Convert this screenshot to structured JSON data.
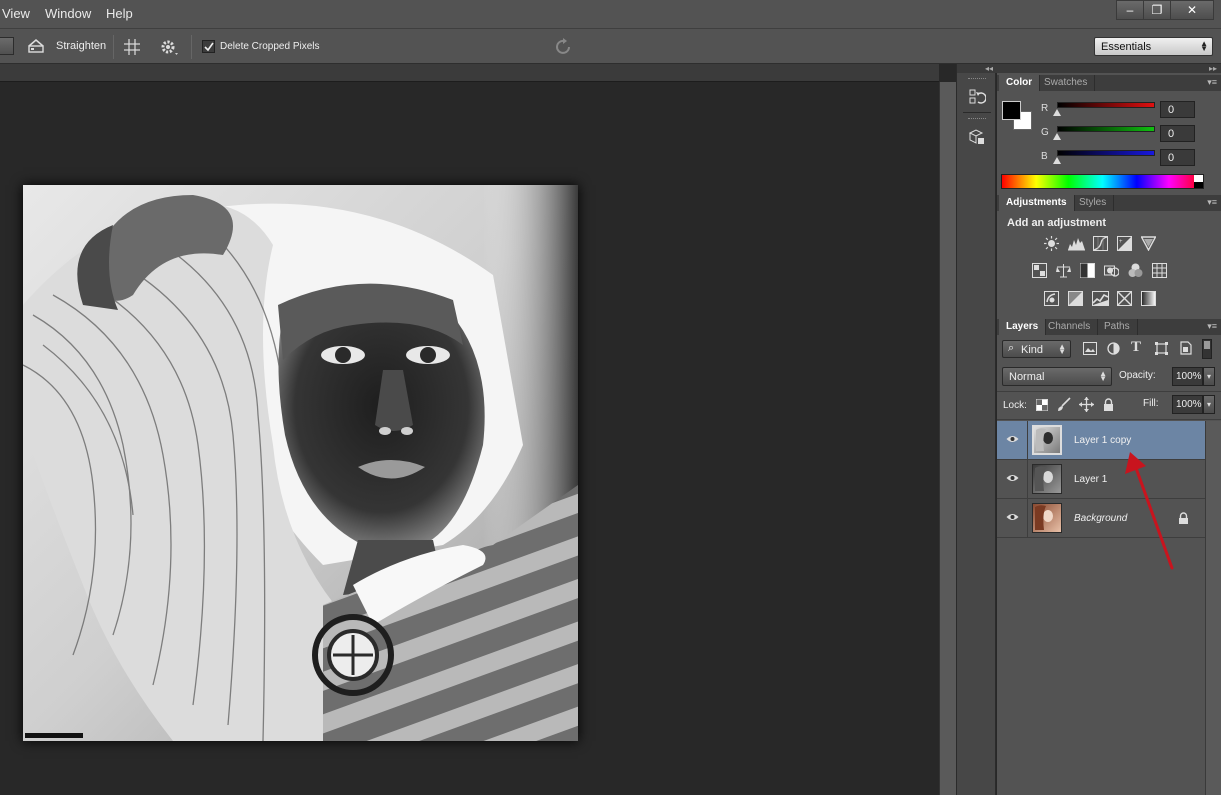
{
  "menu": {
    "items": [
      "View",
      "Window",
      "Help"
    ]
  },
  "window_controls": {
    "minimize": "–",
    "restore": "❐",
    "close": "✕"
  },
  "options_bar": {
    "straighten_label": "Straighten",
    "delete_cropped_label": "Delete Cropped Pixels",
    "delete_cropped_checked": true,
    "workspace_value": "Essentials"
  },
  "color_panel": {
    "tabs": [
      "Color",
      "Swatches"
    ],
    "channels": [
      {
        "label": "R",
        "value": "0",
        "color": "#e01010"
      },
      {
        "label": "G",
        "value": "0",
        "color": "#10c010"
      },
      {
        "label": "B",
        "value": "0",
        "color": "#1818e0"
      }
    ]
  },
  "adjustments_panel": {
    "tabs": [
      "Adjustments",
      "Styles"
    ],
    "heading": "Add an adjustment"
  },
  "layers_panel": {
    "tabs": [
      "Layers",
      "Channels",
      "Paths"
    ],
    "filter_label": "Kind",
    "blend_mode": "Normal",
    "opacity_label": "Opacity:",
    "opacity_value": "100%",
    "lock_label": "Lock:",
    "fill_label": "Fill:",
    "fill_value": "100%",
    "layers": [
      {
        "name": "Layer 1 copy",
        "selected": true
      },
      {
        "name": "Layer 1",
        "selected": false
      },
      {
        "name": "Background",
        "selected": false,
        "locked": true
      }
    ]
  },
  "colors": {
    "selected_layer": "#6c85a4",
    "annotation_arrow": "#c8141e"
  }
}
